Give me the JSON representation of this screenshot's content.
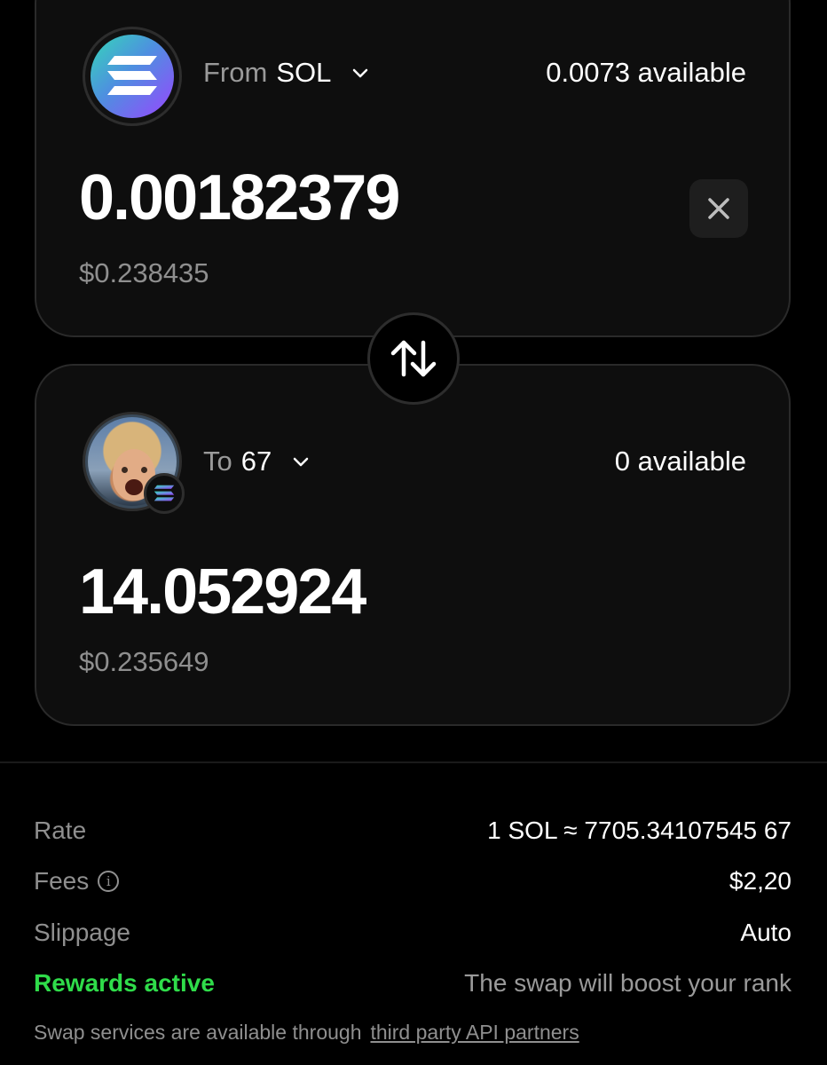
{
  "from": {
    "prefix": "From",
    "symbol": "SOL",
    "available": "0.0073 available",
    "amount": "0.00182379",
    "usd": "$0.238435",
    "icon": "solana-logo-icon"
  },
  "to": {
    "prefix": "To",
    "symbol": "67",
    "available": "0 available",
    "amount": "14.052924",
    "usd": "$0.235649",
    "icon": "token-67-avatar",
    "chain_badge_icon": "solana-logo-icon"
  },
  "details": {
    "rate_label": "Rate",
    "rate_value": "1 SOL ≈ 7705.34107545 67",
    "fees_label": "Fees",
    "fees_value": "$2,20",
    "slippage_label": "Slippage",
    "slippage_value": "Auto",
    "rewards_label": "Rewards active",
    "rewards_value": "The swap will boost your rank"
  },
  "footer": {
    "text": "Swap services are available through",
    "link": "third party API partners"
  },
  "colors": {
    "background": "#000000",
    "card": "#0e0e0e",
    "rewards_green": "#2fdc4a",
    "muted_text": "#8f8f8f"
  }
}
